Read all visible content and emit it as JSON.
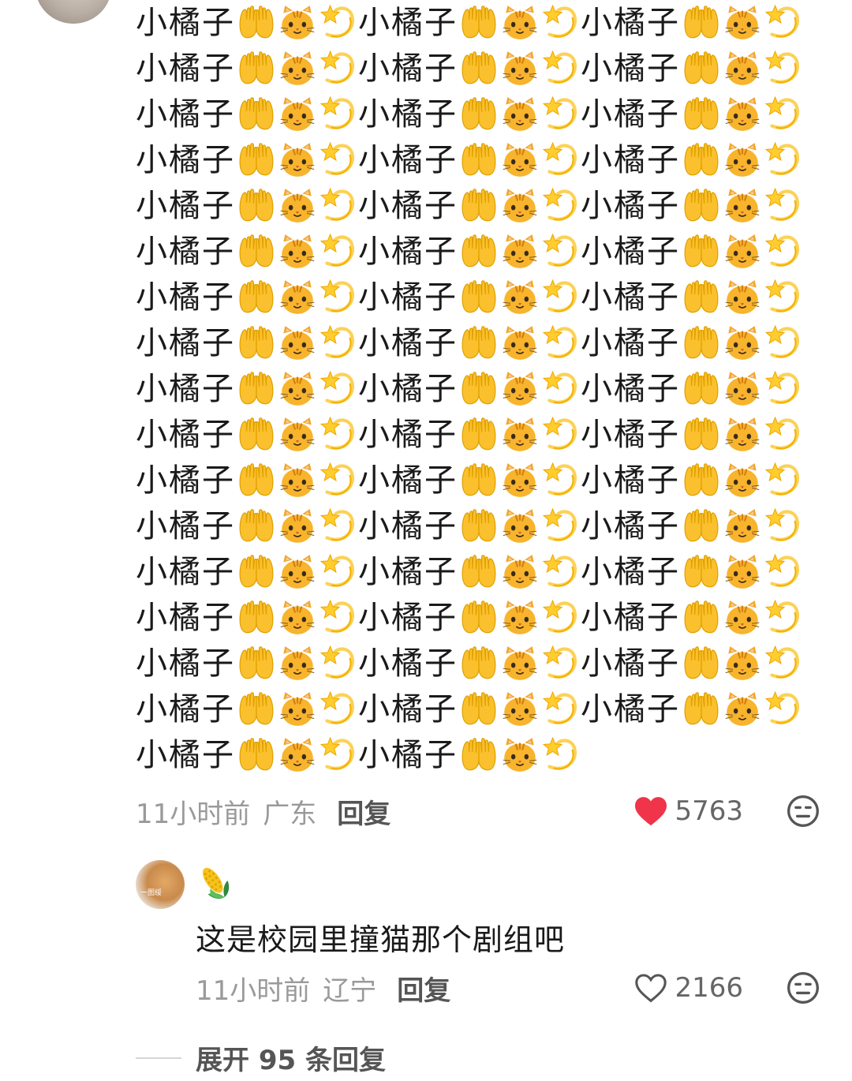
{
  "comment": {
    "lines": [
      {
        "segments": [
          "小橘子",
          "小橘子",
          "小橘子"
        ]
      },
      {
        "segments": [
          "小橘子",
          "小橘子",
          "小橘子"
        ]
      },
      {
        "segments": [
          "小橘子",
          "小橘子",
          "小橘子"
        ]
      },
      {
        "segments": [
          "小橘子",
          "小橘子",
          "小橘子"
        ]
      },
      {
        "segments": [
          "小橘子",
          "小橘子",
          "小橘子"
        ]
      },
      {
        "segments": [
          "小橘子",
          "小橘子",
          "小橘子"
        ]
      },
      {
        "segments": [
          "小橘子",
          "小橘子",
          "小橘子"
        ]
      },
      {
        "segments": [
          "小橘子",
          "小橘子",
          "小橘子"
        ]
      },
      {
        "segments": [
          "小橘子",
          "小橘子",
          "小橘子"
        ]
      },
      {
        "segments": [
          "小橘子",
          "小橘子",
          "小橘子"
        ]
      },
      {
        "segments": [
          "小橘子",
          "小橘子",
          "小橘子"
        ]
      },
      {
        "segments": [
          "小橘子",
          "小橘子",
          "小橘子"
        ]
      },
      {
        "segments": [
          "小橘子",
          "小橘子",
          "小橘子"
        ]
      },
      {
        "segments": [
          "小橘子",
          "小橘子",
          "小橘子"
        ]
      },
      {
        "segments": [
          "小橘子",
          "小橘子",
          "小橘子"
        ]
      },
      {
        "segments": [
          "小橘子",
          "小橘子",
          "小橘子"
        ]
      },
      {
        "segments": [
          "小橘子",
          "小橘子"
        ]
      }
    ],
    "emoji_sequence": [
      "palms-up-together-icon",
      "cat-face-icon",
      "dizzy-star-icon"
    ],
    "time": "11小时前",
    "location": "广东",
    "reply_label": "回复",
    "likes": "5763",
    "liked": true,
    "like_color": "#f0344a"
  },
  "reply": {
    "avatar_caption": "一图绥",
    "name_icon": "corn-icon",
    "text": "这是校园里撞猫那个剧组吧",
    "time": "11小时前",
    "location": "辽宁",
    "reply_label": "回复",
    "likes": "2166",
    "liked": false
  },
  "expand_label": "展开 95 条回复"
}
